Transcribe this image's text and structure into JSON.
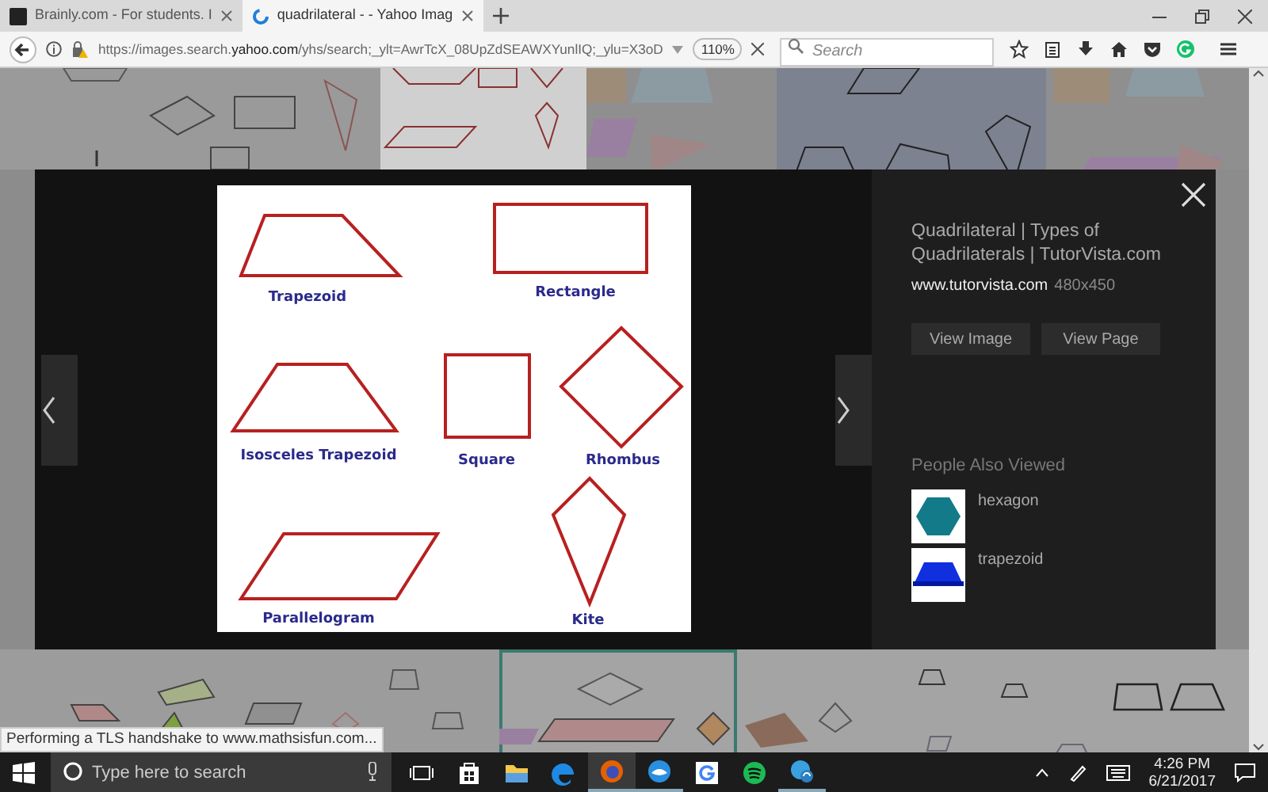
{
  "browser": {
    "tabs": [
      {
        "title": "Brainly.com - For students. I",
        "kind": "brainly",
        "selected": false
      },
      {
        "title": "quadrilateral - - Yahoo Imag",
        "kind": "loading",
        "selected": true
      }
    ],
    "url": "https://images.search.**yahoo.com**/yhs/search;_ylt=AwrTcX_08UpZdSEAWXYunlIQ;_ylu=X3oD",
    "zoom": "110%",
    "search": {
      "placeholder": "Search"
    }
  },
  "viewer": {
    "image": {
      "shapes": [
        {
          "label": "Trapezoid",
          "kind": "trapezoid"
        },
        {
          "label": "Rectangle",
          "kind": "rectangle"
        },
        {
          "label": "Isosceles Trapezoid",
          "kind": "isosceles"
        },
        {
          "label": "Square",
          "kind": "square"
        },
        {
          "label": "Rhombus",
          "kind": "rhombus"
        },
        {
          "label": "Parallelogram",
          "kind": "parallelogram"
        },
        {
          "label": "Kite",
          "kind": "kite"
        }
      ]
    },
    "title": "Quadrilateral | Types of Quadrilaterals | TutorVista.com",
    "source": "www.tutorvista.com",
    "size": "480x450",
    "buttons": [
      "View Image",
      "View Page"
    ],
    "related_heading": "People Also Viewed",
    "related": [
      {
        "label": "hexagon",
        "kind": "hexagon"
      },
      {
        "label": "trapezoid",
        "kind": "trapezoid"
      }
    ]
  },
  "status": "Performing a TLS handshake to www.mathsisfun.com...",
  "taskbar": {
    "search": {
      "placeholder": "Type here to search"
    },
    "apps": [
      {
        "kind": "taskview",
        "running": false
      },
      {
        "kind": "store",
        "running": false
      },
      {
        "kind": "explorer",
        "running": false
      },
      {
        "kind": "edge",
        "running": false
      },
      {
        "kind": "firefox",
        "running": true
      },
      {
        "kind": "mail",
        "running": true
      },
      {
        "kind": "google",
        "running": false
      },
      {
        "kind": "spotify",
        "running": false
      },
      {
        "kind": "sync",
        "running": true
      }
    ],
    "time": "4:26 PM",
    "date": "6/21/2017"
  }
}
